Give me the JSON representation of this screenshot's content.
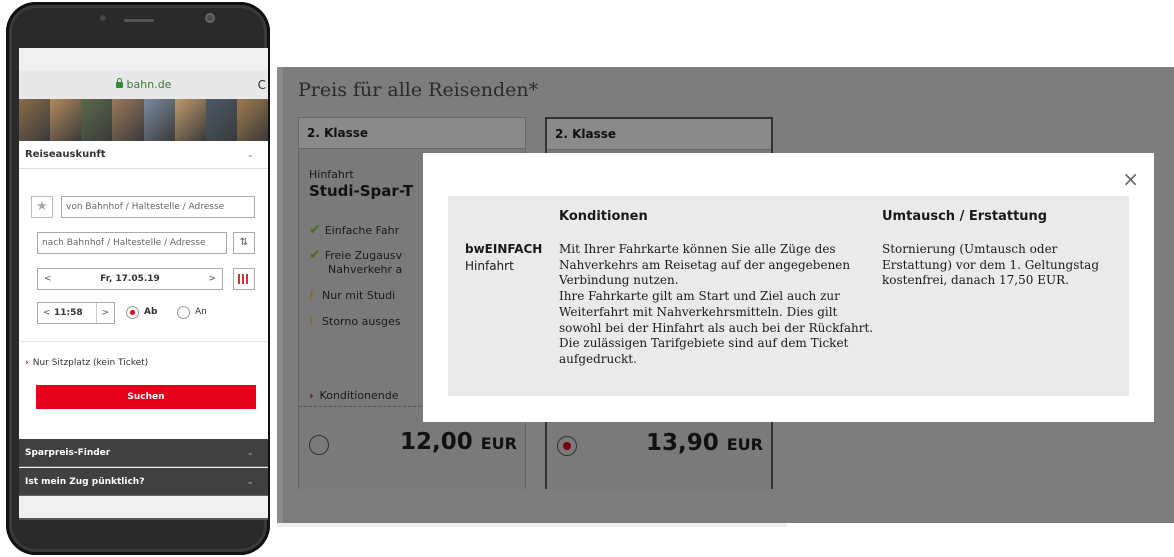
{
  "phone": {
    "url": "bahn.de",
    "section_title": "Reiseauskunft",
    "from_placeholder": "von Bahnhof / Haltestelle / Adresse",
    "to_placeholder": "nach Bahnhof / Haltestelle / Adresse",
    "date_value": "Fr, 17.05.19",
    "date_prev": "<",
    "date_next": ">",
    "time_value": "11:58",
    "time_prev": "<",
    "time_next": ">",
    "radio_ab": "Ab",
    "radio_an": "An",
    "seat_link": "Nur Sitzplatz (kein Ticket)",
    "search_button": "Suchen",
    "accordion_1": "Sparpreis-Finder",
    "accordion_2": "Ist mein Zug pünktlich?",
    "chevron": "⌄",
    "star": "★",
    "swap": "⇅",
    "reload": "C",
    "banner_colors": [
      "#8a6a4a",
      "#b48a5a",
      "#5a6a4a",
      "#9a7a5a",
      "#7a8aa0",
      "#c09a6a",
      "#4a5a6a",
      "#a07a4a"
    ]
  },
  "desktop": {
    "title": "Preis für alle Reisenden*",
    "cards": [
      {
        "class_label": "2. Klasse",
        "direction": "Hinfahrt",
        "product": "Studi-Spar-T",
        "features": [
          {
            "icon": "check",
            "text": "Einfache Fahr"
          },
          {
            "icon": "check",
            "text": "Freie Zugausv"
          },
          {
            "icon": "none",
            "text": "Nahverkehr a"
          },
          {
            "icon": "bang",
            "text": "Nur mit Studi"
          },
          {
            "icon": "bang",
            "text": "Storno ausges"
          }
        ],
        "conditions_link": "Konditionende",
        "price": "12,00",
        "currency": "EUR",
        "selected": false
      },
      {
        "class_label": "2. Klasse",
        "price": "13,90",
        "currency": "EUR",
        "selected": true
      }
    ]
  },
  "modal": {
    "close": "×",
    "col_conditions": "Konditionen",
    "col_refund": "Umtausch / Erstattung",
    "tariff": "bwEINFACH",
    "direction": "Hinfahrt",
    "conditions_text": "Mit Ihrer Fahrkarte können Sie alle Züge des\nNahverkehrs am Reisetag auf der angegebenen\nVerbindung nutzen.\nIhre Fahrkarte gilt am Start und Ziel auch zur\nWeiterfahrt mit Nahverkehrsmitteln. Dies gilt\nsowohl bei der Hinfahrt als auch bei der Rückfahrt.\nDie zulässigen Tarifgebiete sind auf dem Ticket\naufgedruckt.",
    "refund_text": "Stornierung (Umtausch oder\nErstattung) vor dem 1. Geltungstag\nkostenfrei, danach 17,50  EUR."
  },
  "colors": {
    "db_red": "#e2001a",
    "overlay_gray": "#7d7d7d",
    "dark_accordion": "#404040"
  }
}
